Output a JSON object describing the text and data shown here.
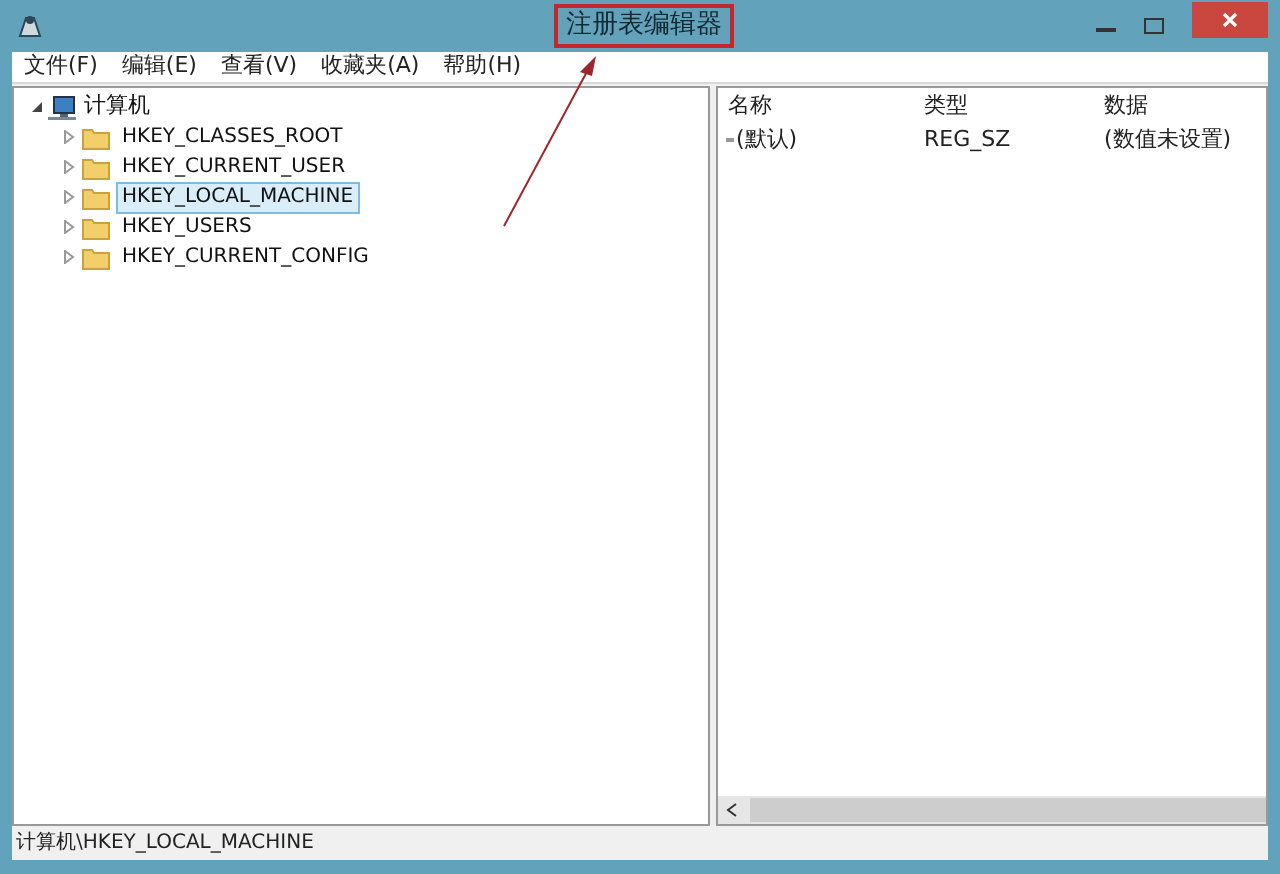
{
  "window": {
    "title": "注册表编辑器"
  },
  "menu": [
    {
      "label": "文件(F)"
    },
    {
      "label": "编辑(E)"
    },
    {
      "label": "查看(V)"
    },
    {
      "label": "收藏夹(A)"
    },
    {
      "label": "帮助(H)"
    }
  ],
  "tree": {
    "label": "计算机",
    "expanded": true,
    "children": [
      {
        "label": "HKEY_CLASSES_ROOT",
        "expanded": false,
        "selected": false
      },
      {
        "label": "HKEY_CURRENT_USER",
        "expanded": false,
        "selected": false
      },
      {
        "label": "HKEY_LOCAL_MACHINE",
        "expanded": false,
        "selected": true
      },
      {
        "label": "HKEY_USERS",
        "expanded": false,
        "selected": false
      },
      {
        "label": "HKEY_CURRENT_CONFIG",
        "expanded": false,
        "selected": false
      }
    ]
  },
  "list": {
    "columns": [
      "名称",
      "类型",
      "数据"
    ],
    "rows": [
      {
        "name": "(默认)",
        "type": "REG_SZ",
        "data": "(数值未设置)"
      }
    ]
  },
  "status_bar": "计算机\\HKEY_LOCAL_MACHINE"
}
